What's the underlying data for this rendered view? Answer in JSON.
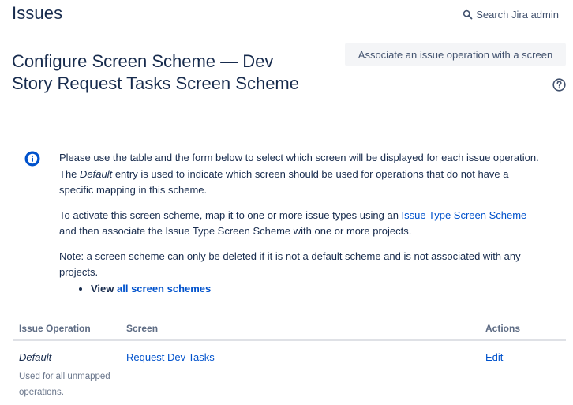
{
  "header": {
    "section_title": "Issues",
    "search_label": "Search Jira admin"
  },
  "page": {
    "title_line1": "Configure Screen Scheme — Dev",
    "title_line2": "Story Request Tasks Screen Scheme",
    "associate_button": "Associate an issue operation with a screen"
  },
  "info": {
    "p1_before": "Please use the table and the form below to select which screen will be displayed for each issue operation. The ",
    "p1_em": "Default",
    "p1_after": " entry is used to indicate which screen should be used for operations that do not have a specific mapping in this scheme.",
    "p2_before": "To activate this screen scheme, map it to one or more issue types using an ",
    "p2_link": "Issue Type Screen Scheme",
    "p2_after": " and then associate the Issue Type Screen Scheme with one or more projects.",
    "p3": "Note: a screen scheme can only be deleted if it is not a default scheme and is not associated with any projects.",
    "view_label": "View ",
    "view_link": "all screen schemes"
  },
  "table": {
    "headers": [
      "Issue Operation",
      "Screen",
      "Actions"
    ],
    "rows": [
      {
        "operation": "Default",
        "description": "Used for all unmapped operations.",
        "screen": "Request Dev Tasks",
        "action": "Edit"
      }
    ]
  },
  "colors": {
    "link": "#0052cc",
    "text": "#172b4d",
    "info_icon": "#0052cc",
    "button_bg": "#f4f5f7"
  }
}
